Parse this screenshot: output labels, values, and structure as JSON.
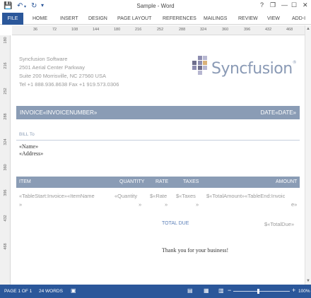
{
  "window": {
    "title": "Sample - Word",
    "help": "?",
    "restore": "❐",
    "minimize": "—",
    "maximize": "☐",
    "close": "✕"
  },
  "quick_access": {
    "save_icon": "💾",
    "undo_icon": "↶",
    "redo_icon": "↻",
    "customize_icon": "▾"
  },
  "ribbon": {
    "tabs": [
      "FILE",
      "HOME",
      "INSERT",
      "DESIGN",
      "PAGE LAYOUT",
      "REFERENCES",
      "MAILINGS",
      "REVIEW",
      "VIEW",
      "ADD-I"
    ]
  },
  "ruler": {
    "marks": [
      "36",
      "72",
      "108",
      "144",
      "180",
      "216",
      "252",
      "288",
      "324",
      "360",
      "396",
      "432",
      "468"
    ],
    "vmarks": [
      "180",
      "216",
      "252",
      "288",
      "324",
      "360",
      "396",
      "432",
      "468"
    ]
  },
  "company": {
    "name": "Syncfusion Software",
    "street": "2501 Aerial Center Parkway",
    "city": "Suite 200 Morrisville, NC 27560 USA",
    "phone": "Tel +1 888.936.8638 Fax +1 919.573.0306"
  },
  "logo": {
    "text": "Syncfusion",
    "reg": "®"
  },
  "invoice": {
    "number_label": "INVOICE«INVOICENUMBER»",
    "date_label": "DATE«DATE»"
  },
  "bill_to": {
    "label": "BILL To",
    "name": "«Name»",
    "address": "«Address»"
  },
  "table": {
    "headers": [
      "ITEM",
      "QUANTITY",
      "RATE",
      "TAXES",
      "AMOUNT"
    ],
    "row": {
      "item": "«TableStart:Invoice»«ItemName",
      "item_cont": "»",
      "quantity": "«Quantity",
      "quantity_cont": "»",
      "rate": "$«Rate",
      "rate_cont": "»",
      "taxes": "$«Taxes",
      "taxes_cont": "»",
      "amount": "$«TotalAmount»«TableEnd:Invoic",
      "amount_cont": "e»"
    }
  },
  "total": {
    "label": "TOTAL DUE",
    "value": "$«TotalDue»"
  },
  "thanks": "Thank you for your business!",
  "status": {
    "page": "PAGE 1 OF 1",
    "words": "24 WORDS",
    "zoom_minus": "−",
    "zoom_plus": "+",
    "zoom": "100%"
  },
  "colors": {
    "ribbon_blue": "#2b579a",
    "band": "#8a9cb5",
    "logo_grid": [
      "#6e6e8c",
      "#8d8db0",
      "#b7b7d1",
      "#d9b27a"
    ]
  }
}
